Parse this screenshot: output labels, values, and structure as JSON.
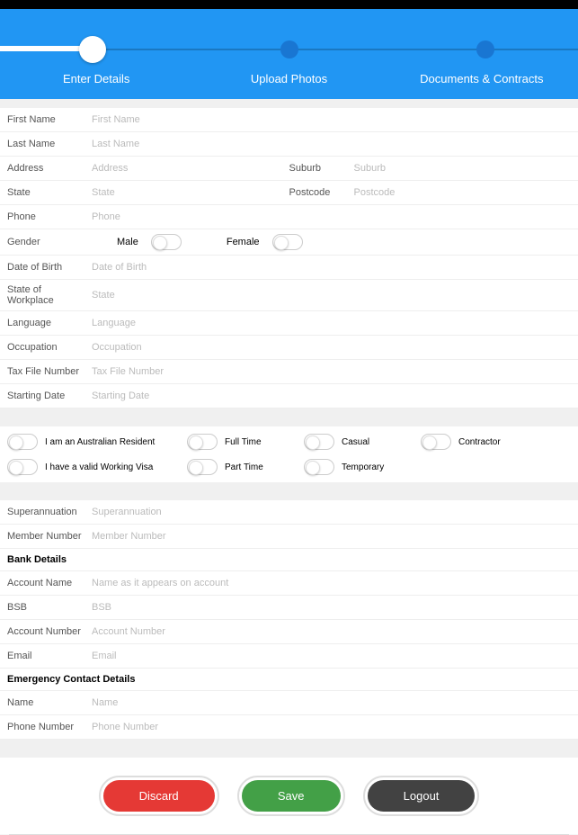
{
  "steps": [
    "Enter Details",
    "Upload Photos",
    "Documents & Contracts"
  ],
  "fields": {
    "firstName": {
      "label": "First Name",
      "placeholder": "First Name"
    },
    "lastName": {
      "label": "Last Name",
      "placeholder": "Last Name"
    },
    "address": {
      "label": "Address",
      "placeholder": "Address"
    },
    "suburb": {
      "label": "Suburb",
      "placeholder": "Suburb"
    },
    "state": {
      "label": "State",
      "placeholder": "State"
    },
    "postcode": {
      "label": "Postcode",
      "placeholder": "Postcode"
    },
    "phone": {
      "label": "Phone",
      "placeholder": "Phone"
    },
    "gender": {
      "label": "Gender",
      "male": "Male",
      "female": "Female"
    },
    "dob": {
      "label": "Date of Birth",
      "placeholder": "Date of Birth"
    },
    "workState": {
      "label": "State of Workplace",
      "placeholder": "State"
    },
    "language": {
      "label": "Language",
      "placeholder": "Language"
    },
    "occupation": {
      "label": "Occupation",
      "placeholder": "Occupation"
    },
    "tfn": {
      "label": "Tax File Number",
      "placeholder": "Tax File Number"
    },
    "startDate": {
      "label": "Starting Date",
      "placeholder": "Starting Date"
    },
    "super": {
      "label": "Superannuation",
      "placeholder": "Superannuation"
    },
    "memberNo": {
      "label": "Member Number",
      "placeholder": "Member Number"
    },
    "accountName": {
      "label": "Account Name",
      "placeholder": "Name as it appears on account"
    },
    "bsb": {
      "label": "BSB",
      "placeholder": "BSB"
    },
    "accountNo": {
      "label": "Account Number",
      "placeholder": "Account Number"
    },
    "email": {
      "label": "Email",
      "placeholder": "Email"
    },
    "emName": {
      "label": "Name",
      "placeholder": "Name"
    },
    "emPhone": {
      "label": "Phone Number",
      "placeholder": "Phone Number"
    }
  },
  "checks": {
    "resident": "I am an Australian Resident",
    "visa": "I have a valid Working Visa",
    "fullTime": "Full Time",
    "partTime": "Part Time",
    "casual": "Casual",
    "temporary": "Temporary",
    "contractor": "Contractor"
  },
  "sections": {
    "bank": "Bank Details",
    "emergency": "Emergency Contact Details"
  },
  "buttons": {
    "discard": "Discard",
    "save": "Save",
    "logout": "Logout"
  }
}
